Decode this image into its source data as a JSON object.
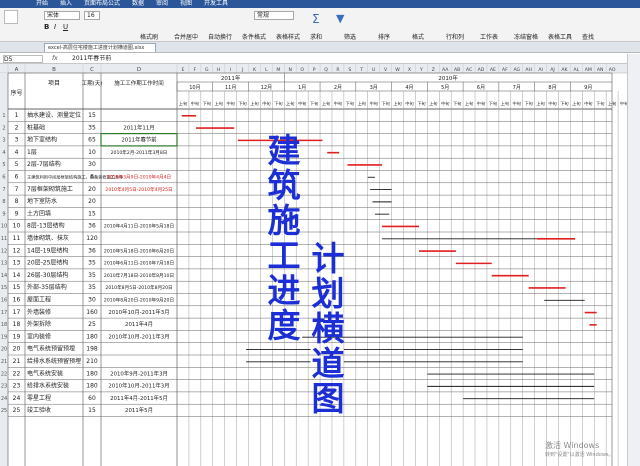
{
  "ribbon_tabs": [
    "开始",
    "插入",
    "页面布局",
    "公式",
    "数据",
    "审阅",
    "视图",
    "开发工具"
  ],
  "ribbon": {
    "font_name": "宋体",
    "font_size": "16",
    "format_name": "常规",
    "labels": [
      "格式刷",
      "合并居中",
      "自动换行",
      "条件格式",
      "表格样式",
      "求和",
      "筛选",
      "排序",
      "格式",
      "行和列",
      "工作表",
      "冻结窗格",
      "表格工具",
      "查找"
    ]
  },
  "document_tab": "excel-高层住宅楼施工进度计划横道图.xlsx",
  "formula_bar": {
    "cell_ref": "D5",
    "fx": "fx",
    "content": "2011年春节前"
  },
  "column_headers": {
    "fixed": [
      "A",
      "B",
      "C",
      "D"
    ],
    "gantt": [
      "E",
      "F",
      "G",
      "H",
      "I",
      "J",
      "K",
      "L",
      "M",
      "N",
      "O",
      "P",
      "Q",
      "R",
      "S",
      "T",
      "U",
      "V",
      "W",
      "X",
      "Y",
      "Z",
      "AA",
      "AB",
      "AC",
      "AD",
      "AE",
      "AF",
      "AG",
      "AH",
      "AI",
      "AJ",
      "AK",
      "AL",
      "AM",
      "AN",
      "AO",
      "AP",
      "AQ"
    ]
  },
  "header_cells": {
    "seq": "序号",
    "item": "项目",
    "days": "工期(天)",
    "date": "施工工作期工作时间"
  },
  "years": [
    "2011年",
    "2010年"
  ],
  "months": [
    "10月",
    "11月",
    "12月",
    "1月",
    "2月",
    "3月",
    "4月",
    "5月",
    "6月",
    "7月",
    "8月",
    "9月"
  ],
  "dekad_labels": [
    "上旬",
    "中旬",
    "下旬"
  ],
  "rows": [
    {
      "n": "1",
      "item": "抽水建设、测量定位",
      "days": "15",
      "date": "",
      "red": false
    },
    {
      "n": "2",
      "item": "桩基础",
      "days": "35",
      "date": "2011年11月",
      "red": false
    },
    {
      "n": "3",
      "item": "地下室结构",
      "days": "65",
      "date": "2011年春节前",
      "red": false
    },
    {
      "n": "4",
      "item": "1层",
      "days": "10",
      "date": "2010年2月-2011年3月8日",
      "red": false
    },
    {
      "n": "5",
      "item": "2层-7层结构",
      "days": "30",
      "date": "",
      "red": false
    },
    {
      "n": "6",
      "item": "主建筑利用中间层框架结构施工，具备装修施工条件",
      "days": "6",
      "date": "2010年3月9日-2010年4月4日",
      "red": true
    },
    {
      "n": "7",
      "item": "7层框架砌筑施工",
      "days": "20",
      "date": "2010年4月5日-2010年4月25日",
      "red": true
    },
    {
      "n": "8",
      "item": "地下室防水",
      "days": "20",
      "date": "",
      "red": false
    },
    {
      "n": "9",
      "item": "土方回填",
      "days": "15",
      "date": "",
      "red": false
    },
    {
      "n": "10",
      "item": "8层-13层结构",
      "days": "36",
      "date": "2010年4月11日-2010年5月18日",
      "red": false
    },
    {
      "n": "11",
      "item": "墙体砌筑、抹灰",
      "days": "120",
      "date": "",
      "red": false
    },
    {
      "n": "12",
      "item": "14层-19层结构",
      "days": "36",
      "date": "2010年5月18日-2010年6月20日",
      "red": false
    },
    {
      "n": "13",
      "item": "20层-25层结构",
      "days": "35",
      "date": "2010年6月11日-2010年7月18日",
      "red": false
    },
    {
      "n": "14",
      "item": "26层-30层结构",
      "days": "35",
      "date": "2010年7月18日-2010年8月10日",
      "red": false
    },
    {
      "n": "15",
      "item": "外部-35层结构",
      "days": "35",
      "date": "2010年8月5日-2010年8月20日",
      "red": false
    },
    {
      "n": "16",
      "item": "屋面工程",
      "days": "30",
      "date": "2010年8月20日-2010年9月20日",
      "red": false
    },
    {
      "n": "17",
      "item": "外墙装修",
      "days": "160",
      "date": "2010年10月-2011年3月",
      "red": false
    },
    {
      "n": "18",
      "item": "外架拆除",
      "days": "25",
      "date": "2011年4月",
      "red": false
    },
    {
      "n": "19",
      "item": "室内装修",
      "days": "180",
      "date": "2010年10月-2011年3月",
      "red": false
    },
    {
      "n": "20",
      "item": "电气系统预留预埋",
      "days": "198",
      "date": "",
      "red": false
    },
    {
      "n": "21",
      "item": "给排水系统预留预埋",
      "days": "210",
      "date": "",
      "red": false
    },
    {
      "n": "22",
      "item": "电气系统安装",
      "days": "180",
      "date": "2010年9月-2011年3月",
      "red": false
    },
    {
      "n": "23",
      "item": "给排水系统安装",
      "days": "180",
      "date": "2010年10月-2011年3月",
      "red": false
    },
    {
      "n": "24",
      "item": "零星工程",
      "days": "60",
      "date": "2011年4月-2011年5月",
      "red": false
    },
    {
      "n": "25",
      "item": "竣工验收",
      "days": "15",
      "date": "2011年5月",
      "red": false
    }
  ],
  "bars": [
    {
      "row": 0,
      "start": 0.4,
      "end": 1.6,
      "color": "red"
    },
    {
      "row": 1,
      "start": 1.6,
      "end": 4.8,
      "color": "red"
    },
    {
      "row": 2,
      "start": 5.1,
      "end": 12.2,
      "color": "red"
    },
    {
      "row": 3,
      "start": 12.6,
      "end": 13.6,
      "color": "red"
    },
    {
      "row": 4,
      "start": 14.3,
      "end": 17.2,
      "color": "red"
    },
    {
      "row": 5,
      "start": 16.0,
      "end": 16.6,
      "color": "black"
    },
    {
      "row": 6,
      "start": 16.2,
      "end": 18.0,
      "color": "black"
    },
    {
      "row": 7,
      "start": 16.4,
      "end": 18.0,
      "color": "black"
    },
    {
      "row": 8,
      "start": 16.6,
      "end": 17.8,
      "color": "black"
    },
    {
      "row": 9,
      "start": 17.2,
      "end": 20.3,
      "color": "red"
    },
    {
      "row": 10,
      "start": 17.2,
      "end": 30.2,
      "color": "black"
    },
    {
      "row": 10,
      "start": 30.2,
      "end": 33.4,
      "color": "red"
    },
    {
      "row": 11,
      "start": 20.3,
      "end": 23.4,
      "color": "red"
    },
    {
      "row": 12,
      "start": 23.4,
      "end": 26.4,
      "color": "red"
    },
    {
      "row": 13,
      "start": 26.4,
      "end": 29.5,
      "color": "red"
    },
    {
      "row": 14,
      "start": 29.5,
      "end": 32.6,
      "color": "red"
    },
    {
      "row": 15,
      "start": 30.8,
      "end": 34.2,
      "color": "black"
    },
    {
      "row": 16,
      "start": 34.2,
      "end": 35.2,
      "color": "red"
    },
    {
      "row": 17,
      "start": 34.6,
      "end": 35.2,
      "color": "red"
    },
    {
      "row": 18,
      "start": 10.5,
      "end": 29.0,
      "color": "black"
    },
    {
      "row": 19,
      "start": 5.8,
      "end": 11.2,
      "color": "black"
    },
    {
      "row": 19,
      "start": 14.0,
      "end": 29.0,
      "color": "black"
    },
    {
      "row": 20,
      "start": 5.8,
      "end": 11.2,
      "color": "black"
    },
    {
      "row": 20,
      "start": 14.0,
      "end": 29.0,
      "color": "black"
    },
    {
      "row": 21,
      "start": 21.0,
      "end": 35.0,
      "color": "black"
    },
    {
      "row": 22,
      "start": 21.0,
      "end": 35.0,
      "color": "black"
    },
    {
      "row": 23,
      "start": 24.0,
      "end": 35.0,
      "color": "black"
    }
  ],
  "overlay_title": {
    "col1": [
      "建",
      "筑",
      "施",
      "工",
      "进",
      "度"
    ],
    "col2": [
      "计",
      "划",
      "横",
      "道",
      "图"
    ]
  },
  "watermark": {
    "line1": "激活 Windows",
    "line2": "转到\"设置\"以激活 Windows。"
  },
  "colors": {
    "bar_red": "#e02020",
    "bar_black": "#1a1a1a",
    "title_blue": "#1c2fd6",
    "ribbon_blue": "#2b579a"
  }
}
